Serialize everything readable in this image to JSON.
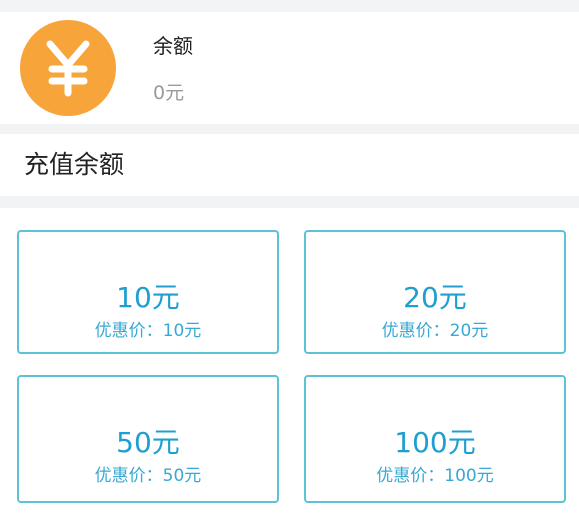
{
  "balance": {
    "icon": "yen-coin-icon",
    "label": "余额",
    "value": "0元"
  },
  "recharge": {
    "title": "充值余额",
    "options": [
      {
        "amount": "10元",
        "price": "优惠价：10元"
      },
      {
        "amount": "20元",
        "price": "优惠价：20元"
      },
      {
        "amount": "50元",
        "price": "优惠价：50元"
      },
      {
        "amount": "100元",
        "price": "优惠价：100元"
      }
    ]
  },
  "colors": {
    "coin": "#f7a43a",
    "option_border": "#5cc2d6",
    "option_text": "#1f9fd0",
    "background": "#f2f3f5"
  }
}
